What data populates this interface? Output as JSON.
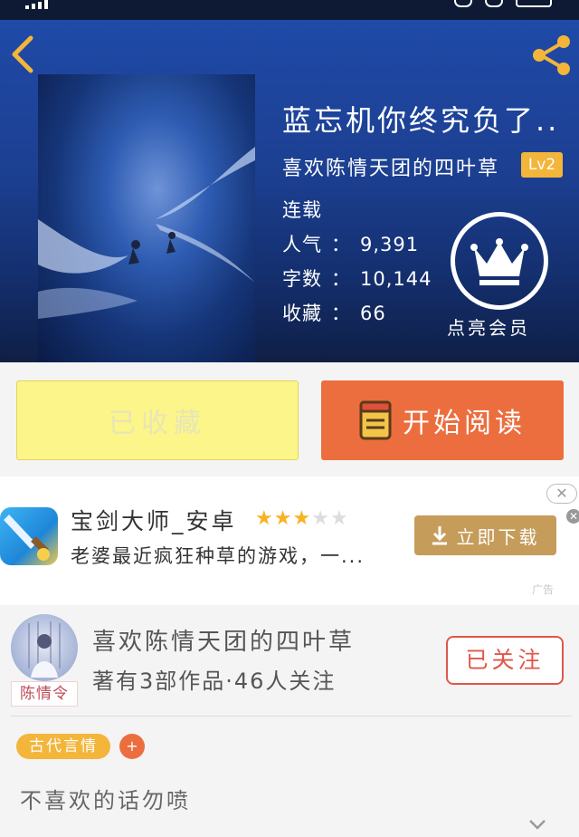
{
  "book": {
    "title": "蓝忘机你终究负了..",
    "author": "喜欢陈情天团的四叶草",
    "level": "Lv2",
    "status": "连载",
    "popularity_label": "人气",
    "popularity": "9,391",
    "words_label": "字数",
    "words": "10,144",
    "favorites_label": "收藏",
    "favorites": "66",
    "colon": "：",
    "vip_label": "点亮会员"
  },
  "actions": {
    "favorite_label": "已收藏",
    "read_label": "开始阅读"
  },
  "ad": {
    "title": "宝剑大师_安卓",
    "rating": 3,
    "rating_max": 5,
    "description": "老婆最近疯狂种草的游戏，一...",
    "download_label": "立即下载",
    "tag": "广告",
    "close_glyph": "✕"
  },
  "author_card": {
    "name": "喜欢陈情天团的四叶草",
    "stats": "著有3部作品·46人关注",
    "follow_label": "已关注",
    "avatar_tag": "陈情令"
  },
  "tags": {
    "genre": "古代言情",
    "add_glyph": "+"
  },
  "summary": "不喜欢的话勿喷",
  "colors": {
    "accent_orange": "#ec6e3e",
    "badge_gold": "#f3b53a",
    "follow_red": "#e0574a",
    "fav_yellow": "#fcf58a",
    "download_tan": "#c69c5b"
  },
  "icons": {
    "back": "chevron-left-icon",
    "share": "share-icon",
    "vip": "crown-icon",
    "read": "book-icon",
    "download": "download-icon",
    "expand": "chevron-down-icon"
  }
}
